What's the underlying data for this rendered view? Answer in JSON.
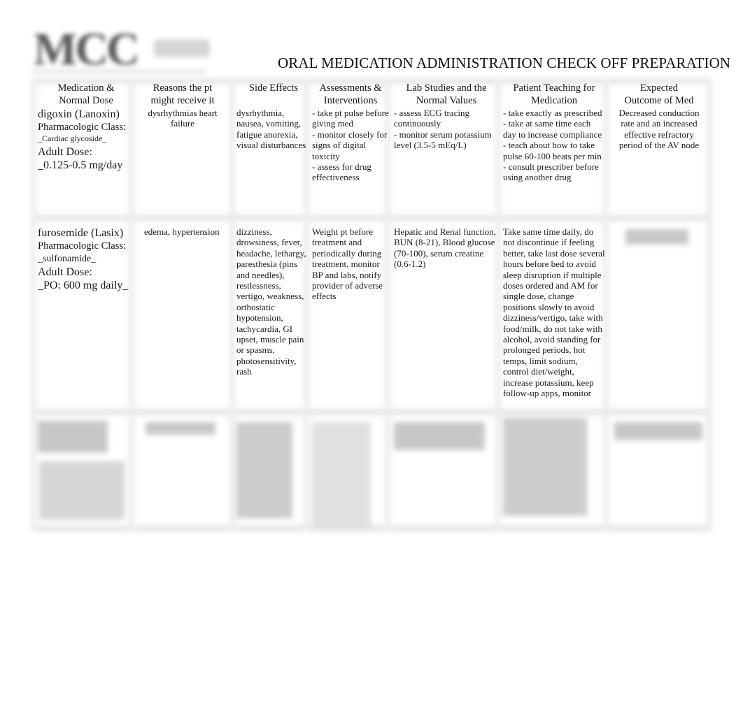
{
  "header": {
    "logo_text": "MCC",
    "title": "ORAL MEDICATION ADMINISTRATION CHECK OFF PREPARATION"
  },
  "table": {
    "columns": [
      "Medication & Normal Dose",
      "Reasons the pt might receive it",
      "Side Effects",
      "Assessments & Interventions",
      "Lab Studies and the Normal Values",
      "Patient Teaching for Medication",
      "Expected Outcome of Med"
    ],
    "column_lines": [
      [
        "Medication &",
        "Normal Dose"
      ],
      [
        "Reasons the pt",
        "might receive it"
      ],
      [
        "Side Effects"
      ],
      [
        "Assessments &",
        "Interventions"
      ],
      [
        "Lab Studies and the",
        "Normal Values"
      ],
      [
        "Patient Teaching for",
        "Medication"
      ],
      [
        "Expected",
        "Outcome of Med"
      ]
    ],
    "rows": [
      {
        "medication": {
          "name": "digoxin (Lanoxin)",
          "class_label": "Pharmacologic Class:",
          "class_value": "_Cardiac glycoside_",
          "dose_label": "Adult Dose:",
          "dose_value": "_0.125-0.5 mg/day"
        },
        "reasons": "dysrhythmias heart failure",
        "side_effects": "dysrhythmia, nausea, vomiting, fatigue anorexia, visual disturbances",
        "assessments": [
          "- take pt pulse before giving med",
          "- monitor closely for signs of digital toxicity",
          "- assess for drug effectiveness"
        ],
        "labs": [
          "- assess ECG tracing continuously",
          "- monitor serum potassium level (3.5-5 mEq/L)"
        ],
        "teaching": [
          "- take exactly as prescribed",
          "- take at same time each day to increase compliance",
          "- teach about how to take pulse 60-100 beats per min",
          "- consult prescriber before using another drug"
        ],
        "outcome": "Decreased conduction rate and an increased effective refractory period of the AV node"
      },
      {
        "medication": {
          "name": "furosemide (Lasix)",
          "class_label": "Pharmacologic Class:",
          "class_value": "_sulfonamide_",
          "dose_label": "Adult Dose:",
          "dose_value": "_PO: 600 mg daily_"
        },
        "reasons": "edema, hypertension",
        "side_effects": "dizziness, drowsiness, fever, headache, lethargy, paresthesia (pins and needles), restlessness, vertigo, weakness, orthostatic hypotension, tachycardia, GI upset, muscle pain or spasms, photosensitivity, rash",
        "assessments": [
          "Weight pt before treatment and periodically during treatment, monitor BP and labs, notify provider of adverse effects"
        ],
        "labs": [
          "Hepatic and Renal function, BUN (8-21), Blood glucose (70-100), serum creatine (0.6-1.2)"
        ],
        "teaching": [
          "Take same time daily, do not discontinue if feeling better, take last dose several hours before bed to avoid sleep disruption if multiple doses ordered and AM for single dose, change positions slowly to avoid dizziness/vertigo, take with food/milk, do not take with alcohol, avoid standing for prolonged periods, hot temps, limit sodium, control diet/weight, increase potassium, keep follow-up apps, monitor"
        ],
        "outcome": "[blurred]"
      },
      {
        "note": "Third row content is blurred/obscured in the screenshot and not legible."
      }
    ]
  }
}
